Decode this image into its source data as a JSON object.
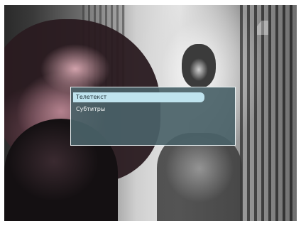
{
  "menu": {
    "items": [
      {
        "label": "Телетекст",
        "selected": true
      },
      {
        "label": "Субтитры",
        "selected": false
      }
    ]
  },
  "colors": {
    "menu_background": "#4a6268",
    "menu_border": "#e9f2f4",
    "selected_item_background": "#bfe3ee",
    "selected_item_text": "#1b2c33",
    "item_text": "#f3f6f6"
  },
  "icons": {
    "channel_logo": "channel-logo-icon"
  }
}
